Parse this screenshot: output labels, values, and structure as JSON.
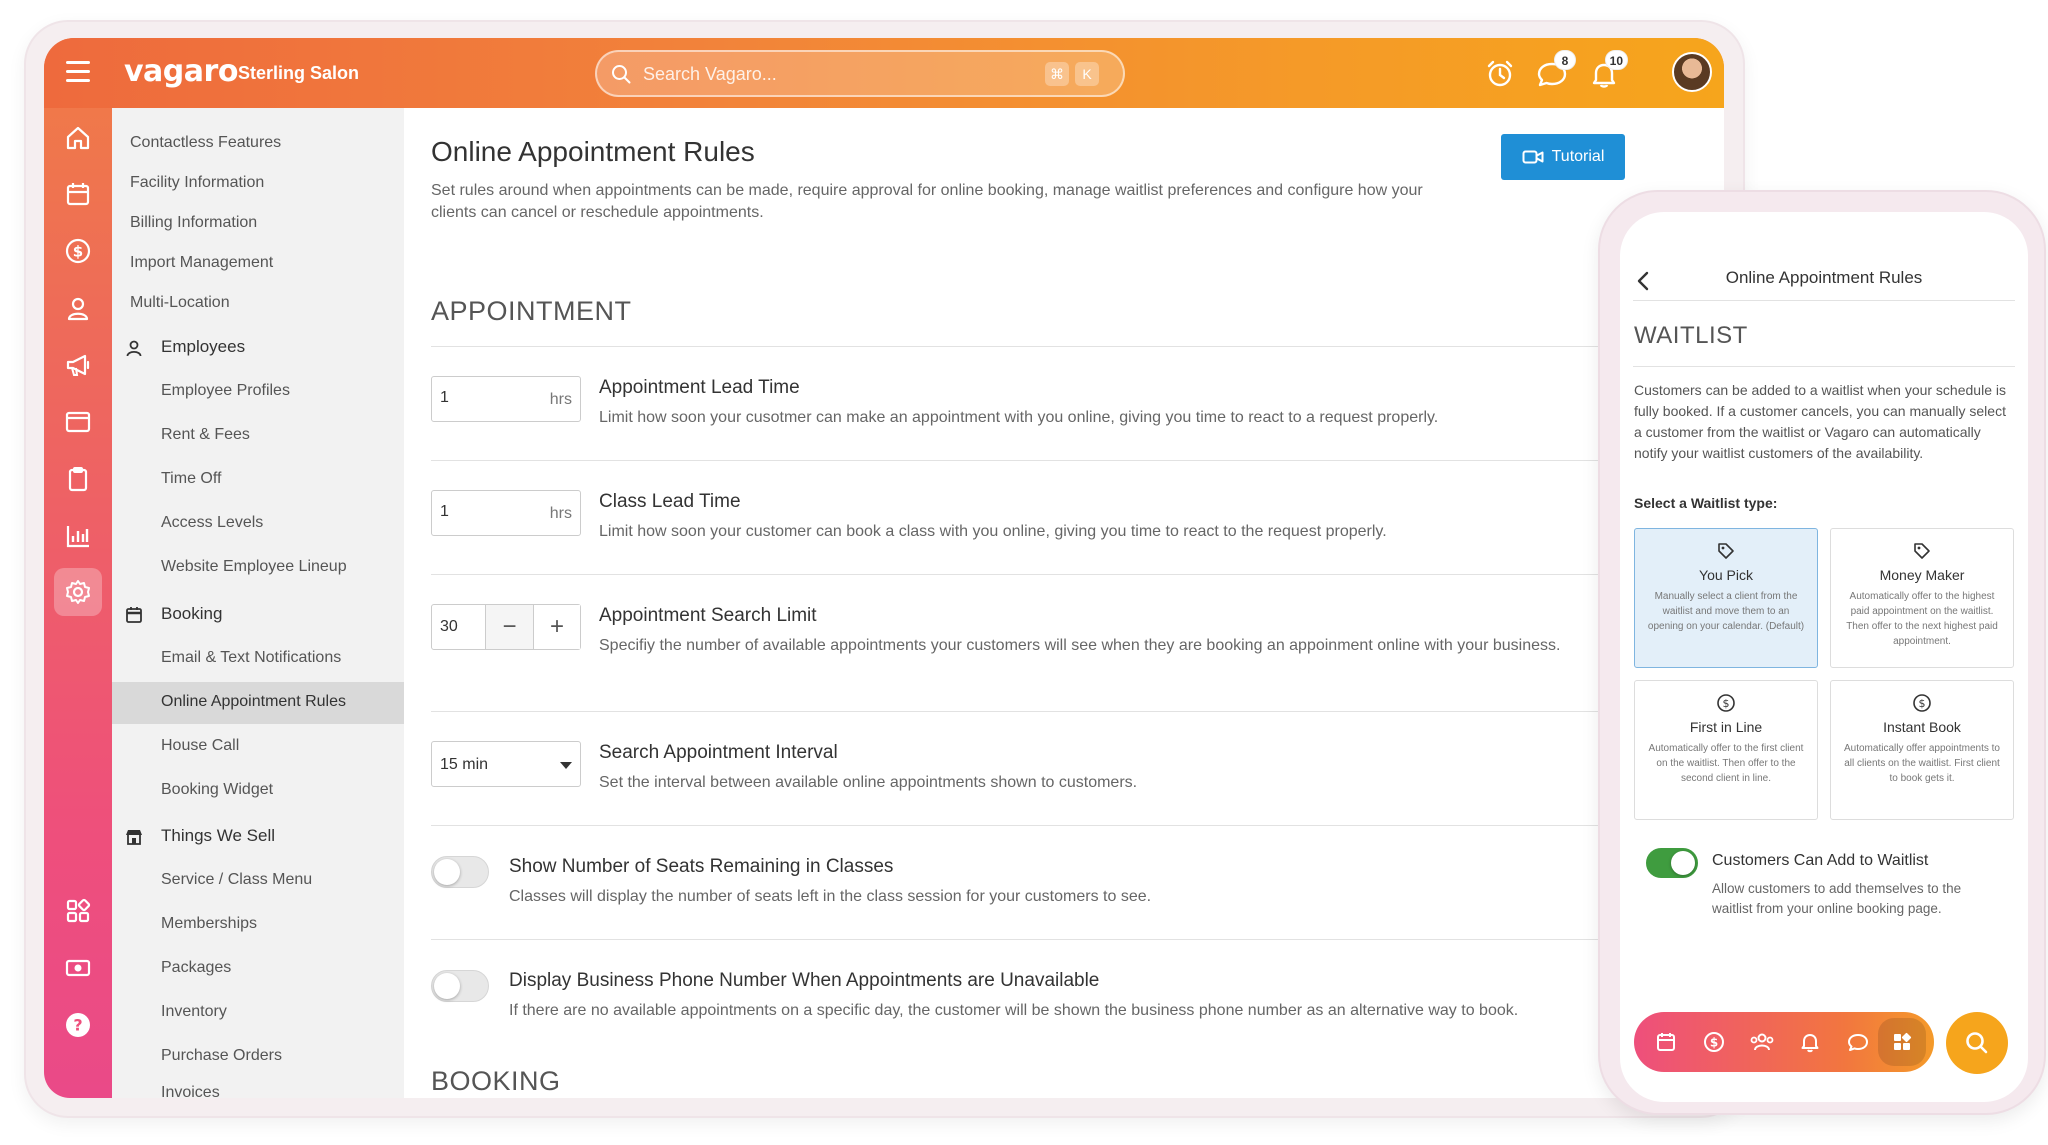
{
  "app": {
    "logo": "vagaro",
    "salon_name": "Sterling Salon",
    "search_placeholder": "Search Vagaro...",
    "search_shortcut_cmd": "⌘",
    "search_shortcut_key": "K",
    "messages_count": "8",
    "notifications_count": "10"
  },
  "rail_icons": [
    "home-icon",
    "calendar-icon",
    "dollar-icon",
    "user-icon",
    "megaphone-icon",
    "browser-icon",
    "clipboard-icon",
    "chart-icon",
    "gear-icon",
    "apps-icon",
    "cash-icon",
    "help-icon"
  ],
  "nav": {
    "top_items": [
      "Contactless Features",
      "Facility Information",
      "Billing Information",
      "Import Management",
      "Multi-Location"
    ],
    "employees_label": "Employees",
    "employees_items": [
      "Employee Profiles",
      "Rent & Fees",
      "Time Off",
      "Access Levels",
      "Website Employee Lineup"
    ],
    "booking_label": "Booking",
    "booking_items": [
      "Email & Text Notifications",
      "Online Appointment Rules",
      "House Call",
      "Booking Widget"
    ],
    "things_label": "Things We Sell",
    "things_items": [
      "Service / Class Menu",
      "Memberships",
      "Packages",
      "Inventory",
      "Purchase Orders",
      "Invoices"
    ],
    "selected": "Online Appointment Rules"
  },
  "main": {
    "title": "Online Appointment Rules",
    "description": "Set rules around when appointments can be made, require approval for online booking, manage waitlist preferences and configure how your clients can cancel or reschedule appointments.",
    "tutorial_label": "Tutorial",
    "section_appointment": "APPOINTMENT",
    "section_booking": "BOOKING",
    "rules": {
      "lead_time": {
        "value": "1",
        "unit": "hrs",
        "title": "Appointment Lead Time",
        "desc": "Limit how soon your cusotmer can make an appointment with you online, giving you time to react to a request properly."
      },
      "class_lead_time": {
        "value": "1",
        "unit": "hrs",
        "title": "Class Lead Time",
        "desc": "Limit how soon your customer can book a class with you online, giving you time to react to the request properly."
      },
      "search_limit": {
        "value": "30",
        "minus": "−",
        "plus": "+",
        "title": "Appointment Search Limit",
        "desc": "Specifiy the number of available appointments your customers will see when they are booking an appoinment online with your business."
      },
      "search_interval": {
        "value": "15 min",
        "title": "Search Appointment Interval",
        "desc": "Set the interval between available online appointments shown to customers."
      },
      "show_seats": {
        "on": false,
        "title": "Show Number of Seats Remaining in Classes",
        "desc": "Classes will display the number of seats left in the class session for your customers to see."
      },
      "display_phone": {
        "on": false,
        "title": "Display Business Phone Number When Appointments are Unavailable",
        "desc": "If there are no available appointments on a specific day, the customer will be shown the business phone number as an alternative way to book."
      }
    }
  },
  "phone": {
    "title": "Online Appointment Rules",
    "section": "WAITLIST",
    "description": "Customers can be added to a waitlist when your schedule is fully booked. If a customer cancels, you can manually select a customer from the waitlist or Vagaro can automatically notify your waitlist customers of the availability.",
    "select_label": "Select a Waitlist type:",
    "waitlist_types": [
      {
        "name": "You Pick",
        "icon": "tag-icon",
        "desc": "Manually select a client from the waitlist and move them to an opening on your calendar. (Default)",
        "selected": true
      },
      {
        "name": "Money Maker",
        "icon": "tag-icon",
        "desc": "Automatically offer to the highest paid appointment on the waitlist. Then offer to the next highest paid appointment.",
        "selected": false
      },
      {
        "name": "First in Line",
        "icon": "dollar-circle-icon",
        "desc": "Automatically offer to the first client on the waitlist. Then offer to the second client in line.",
        "selected": false
      },
      {
        "name": "Instant Book",
        "icon": "dollar-circle-icon",
        "desc": "Automatically offer appointments to all clients on the waitlist. First client to book gets it.",
        "selected": false
      }
    ],
    "add_to_waitlist": {
      "on": true,
      "title": "Customers Can Add to Waitlist",
      "desc": "Allow customers to add themselves to the waitlist from your online booking page."
    },
    "bottom_nav": [
      "calendar-icon",
      "dollar-icon",
      "users-icon",
      "bell-icon",
      "chat-icon",
      "apps-icon"
    ],
    "bottom_nav_active": "apps-icon"
  },
  "colors": {
    "accent_orange": "#f2833a",
    "accent_pink": "#ee4f7c",
    "tutorial_blue": "#1f8fd6",
    "toggle_on_green": "#3f9c3f",
    "selected_card_blue": "#e3eff9"
  }
}
